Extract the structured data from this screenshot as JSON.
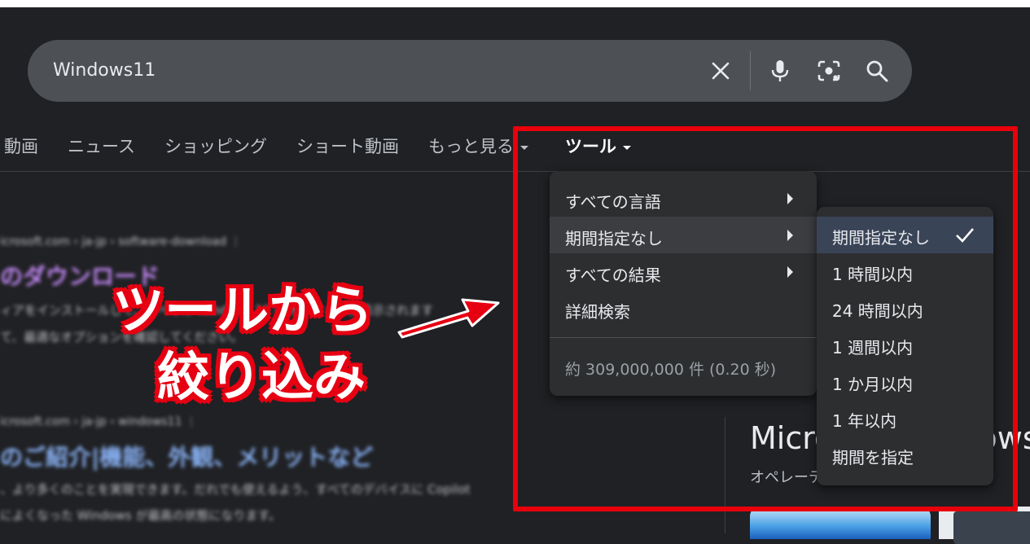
{
  "search": {
    "query": "Windows11",
    "icons": [
      "close-icon",
      "mic-icon",
      "lens-icon",
      "search-icon"
    ]
  },
  "tabs": [
    {
      "label": "動画"
    },
    {
      "label": "ニュース"
    },
    {
      "label": "ショッピング"
    },
    {
      "label": "ショート動画"
    },
    {
      "label": "もっと見る"
    },
    {
      "label": "ツール"
    }
  ],
  "results": {
    "r1_url": "icrosoft.com › ja-jp › software-download ⋮",
    "r1_title": "のダウンロード",
    "r1_snippet1": "ィアをインストールして、すべての Windows 11 のオプションが表示されます",
    "r1_snippet2": "て、最適なオプションを確認してください。",
    "r2_url": "icrosoft.com › ja-jp › windows11 ⋮",
    "r2_title": "のご紹介|機能、外観、メリットなど",
    "r2_snippet1": "、より多くのことを実現できます。だれでも使えるよう、すべてのデバイスに Copilot",
    "r2_snippet2": "によくなった Windows が最高の状態になります。"
  },
  "knowledge_panel": {
    "title": "Microsoft Windows",
    "subtitle": "オペレーティング システム"
  },
  "tools_menu": {
    "items": [
      {
        "label": "すべての言語",
        "has_submenu": true
      },
      {
        "label": "期間指定なし",
        "has_submenu": true
      },
      {
        "label": "すべての結果",
        "has_submenu": true
      },
      {
        "label": "詳細検索",
        "has_submenu": false
      }
    ],
    "result_count": "約 309,000,000 件 (0.20 秒)"
  },
  "time_submenu": {
    "items": [
      {
        "label": "期間指定なし",
        "selected": true
      },
      {
        "label": "1 時間以内"
      },
      {
        "label": "24 時間以内"
      },
      {
        "label": "1 週間以内"
      },
      {
        "label": "1 か月以内"
      },
      {
        "label": "1 年以内"
      },
      {
        "label": "期間を指定"
      }
    ]
  },
  "annotation": {
    "line1": "ツールから",
    "line2": "絞り込み",
    "color": "#e60012"
  },
  "colors": {
    "background": "#202124",
    "search_bar": "#4d5156",
    "menu_bg": "#2d2e30",
    "selected_bg": "#394457",
    "red": "#e8000b"
  }
}
